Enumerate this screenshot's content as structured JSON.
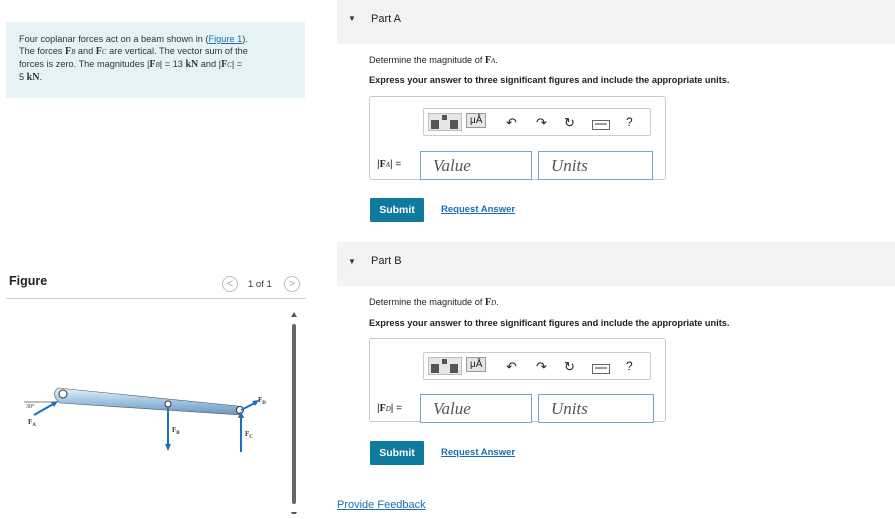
{
  "problem": {
    "line1": "Four coplanar forces act on a beam shown in (",
    "figure_link": "Figure 1",
    "line1_end": ").",
    "line2a": "The forces ",
    "fb": "F",
    "fb_sub": "B",
    "line2b": " and ",
    "fc": "F",
    "fc_sub": "C",
    "line2c": " are vertical. The vector sum of the",
    "line3a": "forces is zero. The magnitudes |",
    "line3b": "| = 13 ",
    "kN": "kN",
    "line3c": " and |",
    "line3d": "| =",
    "line4": "5 ",
    "kN2": "kN",
    "line4_end": "."
  },
  "figure": {
    "title": "Figure",
    "pager": "1 of 1",
    "prev": "<",
    "next": ">",
    "angle_label": "30°",
    "fa": "F",
    "fa_sub": "A",
    "fb": "F",
    "fb_sub": "B",
    "fc": "F",
    "fc_sub": "C",
    "fd": "F",
    "fd_sub": "D"
  },
  "parts": [
    {
      "title": "Part A",
      "question_pre": "Determine the magnitude of ",
      "vec": "F",
      "vec_sub": "A",
      "question_end": ".",
      "instruction": "Express your answer to three significant figures and include the appropriate units.",
      "label_pre": "|",
      "label_vec": "F",
      "label_sub": "A",
      "label_post": "| =",
      "value_placeholder": "Value",
      "units_placeholder": "Units",
      "submit": "Submit",
      "request": "Request Answer"
    },
    {
      "title": "Part B",
      "question_pre": "Determine the magnitude of ",
      "vec": "F",
      "vec_sub": "D",
      "question_end": ".",
      "instruction": "Express your answer to three significant figures and include the appropriate units.",
      "label_pre": "|",
      "label_vec": "F",
      "label_sub": "D",
      "label_post": "| =",
      "value_placeholder": "Value",
      "units_placeholder": "Units",
      "submit": "Submit",
      "request": "Request Answer"
    }
  ],
  "toolbar": {
    "mu_label": "μÅ",
    "help": "?",
    "undo_icon": "undo-icon",
    "redo_icon": "redo-icon",
    "reset_icon": "reset-icon",
    "keyboard_icon": "keyboard-icon",
    "template_icon": "template-icon"
  },
  "feedback": "Provide Feedback",
  "colors": {
    "accent": "#0e7a9e",
    "link": "#1a6fb0",
    "problem_bg": "#e6f3f6",
    "part_header_bg": "#f3f3f3"
  }
}
